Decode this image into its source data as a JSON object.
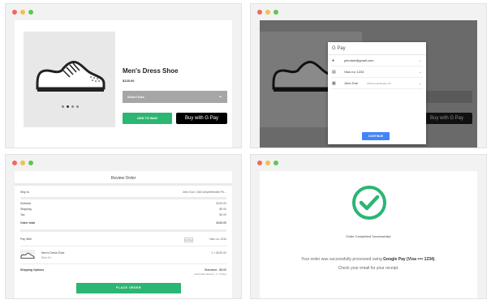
{
  "window_dots": [
    "#ee6a5f",
    "#f5be4f",
    "#61c554"
  ],
  "product": {
    "name": "Men's Dress Shoe",
    "price": "$125.00",
    "size_placeholder": "Select Size",
    "add_to_bag": "ADD TO BAG",
    "buy_with_gpay": "Buy with G Pay",
    "carousel_count": 4,
    "carousel_active": 2
  },
  "gpay_sheet": {
    "header": "G Pay",
    "email": "johndoe@gmail.com",
    "card": "Visa •••• 1234",
    "name": "John Doe",
    "address": "1600 Amphitheatre Pk...",
    "continue": "CONTINUE",
    "buy_with_gpay": "Buy with G Pay"
  },
  "review": {
    "title": "Review Order",
    "ship_to_label": "Ship to",
    "ship_to_value": "John Doe, 1600 Amphitheatre Pk...",
    "subtotal_label": "Subtotal",
    "subtotal_value": "$125.00",
    "shipping_label": "Shipping",
    "shipping_value": "$5.00",
    "tax_label": "Tax",
    "tax_value": "$0.00",
    "total_label": "Order total",
    "total_value": "$130.00",
    "pay_with_label": "Pay With",
    "gpay_chip": "G Pay",
    "card_value": "Visa •••• 1234",
    "item_name": "Men's Dress Shoe",
    "item_size": "Size 10",
    "item_price": "1 × $125.00",
    "shipping_options_label": "Shipping Options",
    "shipping_option": "Standard - $5.00",
    "delivery_estimate": "Estimated delivery: 4 - 5 days",
    "place_order": "PLACE ORDER"
  },
  "success": {
    "title": "Order Completed Successfully!",
    "msg_prefix": "Your order was successfully processed using ",
    "msg_method": "Google Pay (Visa •••• 1234)",
    "msg_suffix": ".",
    "msg_line2": "Check your email for your receipt.",
    "check_color": "#2bb673"
  }
}
